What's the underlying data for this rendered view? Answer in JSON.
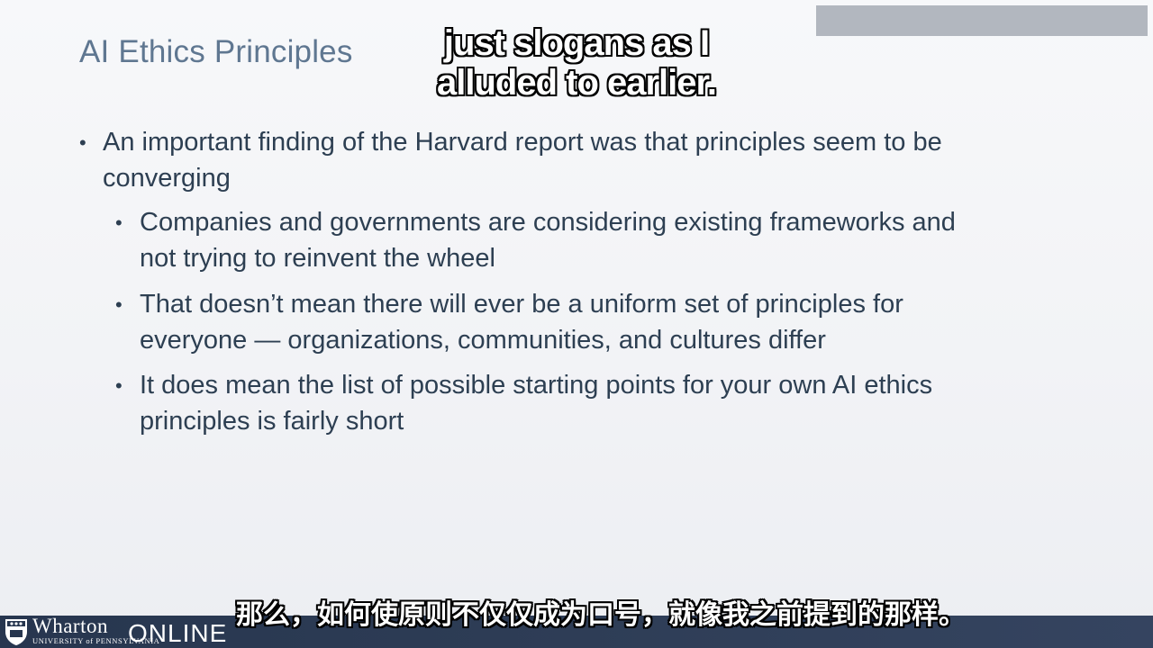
{
  "slide": {
    "title": "AI Ethics Principles",
    "bullets": [
      {
        "level": 1,
        "lines": [
          "An important finding of the Harvard report was that principles seem to be",
          "converging"
        ]
      },
      {
        "level": 2,
        "lines": [
          "Companies and governments are considering existing frameworks and",
          "not trying to reinvent the wheel"
        ]
      },
      {
        "level": 2,
        "lines": [
          "That doesn’t mean there will ever be a uniform set of principles for",
          "everyone — organizations, communities, and cultures differ"
        ]
      },
      {
        "level": 2,
        "lines": [
          "It does mean the list of possible starting points for your own AI ethics",
          "principles is fairly short"
        ]
      }
    ]
  },
  "captions": {
    "english_line1": "just slogans as I",
    "english_line2": "alluded to earlier.",
    "chinese": "那么，如何使原则不仅仅成为口号，就像我之前提到的那样。"
  },
  "footer": {
    "brand": "Wharton",
    "brand_sub": "UNIVERSITY of PENNSYLVANIA",
    "brand_online": "ONLINE",
    "shield_icon": "penn-shield-icon"
  },
  "colors": {
    "title": "#5f7791",
    "body_text": "#2d3f52",
    "footer_bar": "#2e3d56"
  }
}
